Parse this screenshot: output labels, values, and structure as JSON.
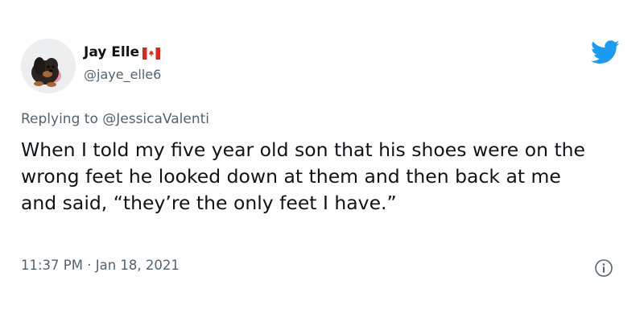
{
  "tweet": {
    "author": {
      "display_name": "Jay Elle",
      "flag_icon": "canada-flag-icon",
      "handle": "@jaye_elle6",
      "avatar_icon": "dog-avatar"
    },
    "logo_icon": "twitter-bird-icon",
    "reply": {
      "prefix": "Replying to",
      "mention": "@JessicaValenti"
    },
    "text": "When I told my five year old son that his shoes were on the wrong feet he looked down at them and then back at me and said, “they’re the only feet I have.”",
    "timestamp": "11:37 PM · Jan 18, 2021",
    "info_icon": "info-icon"
  },
  "colors": {
    "text_primary": "#0f1419",
    "text_secondary": "#536471",
    "twitter_blue": "#1d9bf0",
    "flag_red": "#d52b1e"
  }
}
